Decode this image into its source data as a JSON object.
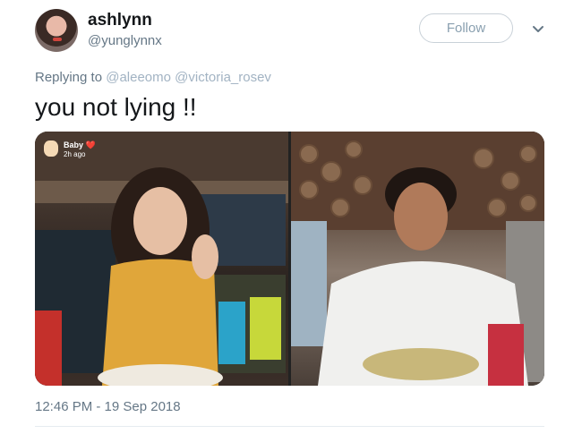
{
  "user": {
    "name": "ashlynn",
    "handle": "@yunglynnx"
  },
  "follow_label": "Follow",
  "reply": {
    "prefix": "Replying to",
    "mentions": [
      "@aleeomo",
      "@victoria_rosev"
    ]
  },
  "tweet_text": "you not lying !!",
  "media": {
    "left_overlay": {
      "name": "Baby",
      "emoji": "❤️",
      "time": "2h ago"
    }
  },
  "timestamp": "12:46 PM - 19 Sep 2018",
  "icons": {
    "more": "chevron-down-icon"
  }
}
